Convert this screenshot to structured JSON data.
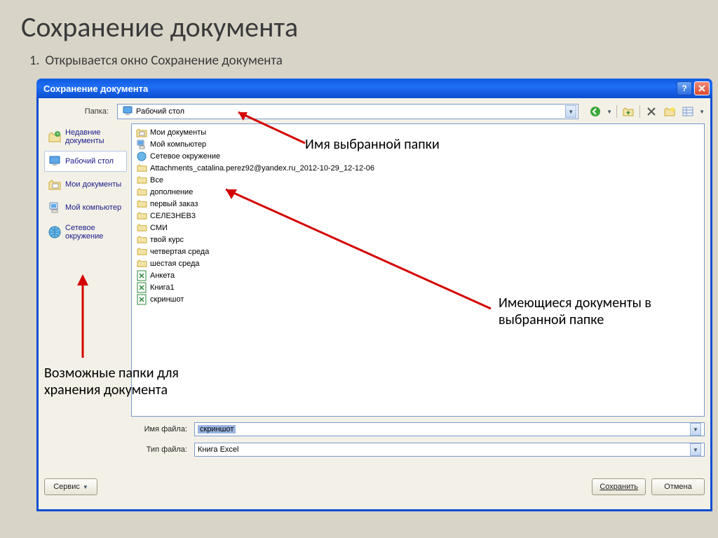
{
  "slide": {
    "title": "Сохранение документа",
    "bullet_number": "1.",
    "bullet_text": "Открывается окно Сохранение документа"
  },
  "dialog": {
    "title": "Сохранение документа",
    "folder_label": "Папка:",
    "folder_value": "Рабочий стол",
    "places": [
      {
        "label": "Недавние документы",
        "icon": "history"
      },
      {
        "label": "Рабочий стол",
        "icon": "desktop",
        "selected": true
      },
      {
        "label": "Мои документы",
        "icon": "mydocs"
      },
      {
        "label": "Мой компьютер",
        "icon": "mycomputer"
      },
      {
        "label": "Сетевое окружение",
        "icon": "network"
      }
    ],
    "files": [
      {
        "label": "Мои документы",
        "icon": "mydocs"
      },
      {
        "label": "Мой компьютер",
        "icon": "mycomputer"
      },
      {
        "label": "Сетевое окружение",
        "icon": "network"
      },
      {
        "label": "Attachments_catalina.perez92@yandex.ru_2012-10-29_12-12-06",
        "icon": "folder"
      },
      {
        "label": "Все",
        "icon": "folder"
      },
      {
        "label": "дополнение",
        "icon": "folder"
      },
      {
        "label": "первый заказ",
        "icon": "folder"
      },
      {
        "label": "СЕЛЕЗНЕВ3",
        "icon": "folder"
      },
      {
        "label": "СМИ",
        "icon": "folder"
      },
      {
        "label": "твой курс",
        "icon": "folder"
      },
      {
        "label": "четвертая среда",
        "icon": "folder"
      },
      {
        "label": "шестая среда",
        "icon": "folder"
      },
      {
        "label": "Анкета",
        "icon": "excel"
      },
      {
        "label": "Книга1",
        "icon": "excel"
      },
      {
        "label": "скриншот",
        "icon": "excel"
      }
    ],
    "filename_label": "Имя файла:",
    "filename_value": "скриншот",
    "filetype_label": "Тип файла:",
    "filetype_value": "Книга Excel",
    "service_button": "Сервис",
    "save_button": "Сохранить",
    "cancel_button": "Отмена"
  },
  "annotations": {
    "top": "Имя выбранной папки",
    "right": "Имеющиеся документы в выбранной папке",
    "left1": "Возможные папки для",
    "left2": "хранения документа"
  }
}
